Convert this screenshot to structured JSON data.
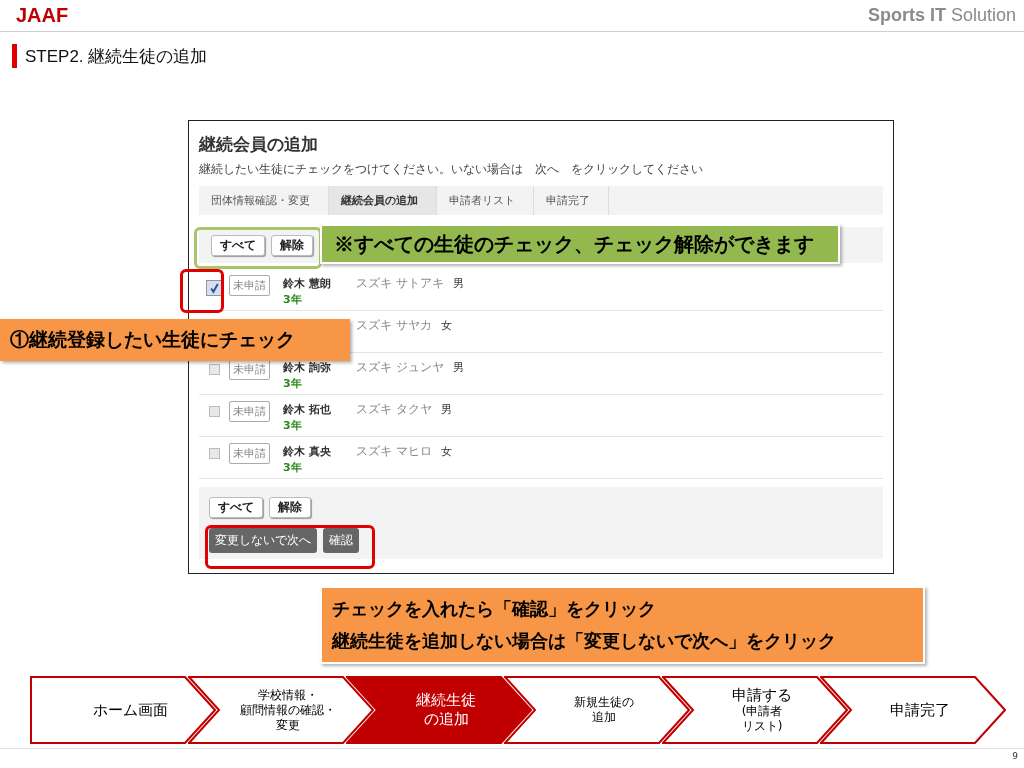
{
  "header": {
    "logo": "JAAF",
    "brand": "**Sports IT** Solution"
  },
  "slide_title": "STEP2. 継続生徒の追加",
  "screenshot": {
    "title": "継続会員の追加",
    "instruction": "継続したい生徒にチェックをつけてください。いない場合は　次へ　をクリックしてください",
    "breadcrumb": [
      {
        "label": "団体情報確認・変更",
        "selected": false
      },
      {
        "label": "継続会員の追加",
        "selected": true
      },
      {
        "label": "申請者リスト",
        "selected": false
      },
      {
        "label": "申請完了",
        "selected": false
      }
    ],
    "top_buttons": [
      "すべて",
      "解除"
    ],
    "students": [
      {
        "checked": true,
        "status": "未申請",
        "name": "鈴木 慧朗",
        "kana": "スズキ サトアキ",
        "gender": "男",
        "grade": "3年"
      },
      {
        "kana": "スズキ サヤカ",
        "gender": "女"
      },
      {
        "checked": false,
        "status": "未申請",
        "name": "鈴木 詢弥",
        "kana": "スズキ ジュンヤ",
        "gender": "男",
        "grade": "3年"
      },
      {
        "checked": false,
        "status": "未申請",
        "name": "鈴木 拓也",
        "kana": "スズキ タクヤ",
        "gender": "男",
        "grade": "3年"
      },
      {
        "checked": false,
        "status": "未申請",
        "name": "鈴木 真央",
        "kana": "スズキ マヒロ",
        "gender": "女",
        "grade": "3年"
      }
    ],
    "bottom_buttons": [
      "すべて",
      "解除"
    ],
    "action_buttons": [
      "変更しないで次へ",
      "確認"
    ]
  },
  "callouts": [
    {
      "kind": "green",
      "lines": [
        "※すべての生徒のチェック、チェック解除ができます"
      ]
    },
    {
      "kind": "orange-left",
      "lines": [
        "①継続登録したい生徒にチェック"
      ]
    },
    {
      "kind": "orange-bottom",
      "lines": [
        "チェックを入れたら「確認」をクリック",
        "継続生徒を追加しない場合は「変更しないで次へ」をクリック"
      ]
    }
  ],
  "steps": [
    {
      "lines": [
        "ホーム画面"
      ],
      "selected": false
    },
    {
      "lines": [
        "学校情報・",
        "顧問情報の確認・",
        "変更"
      ],
      "selected": false
    },
    {
      "lines": [
        "継続生徒",
        "の追加"
      ],
      "selected": true
    },
    {
      "lines": [
        "新規生徒の",
        "追加"
      ],
      "selected": false
    },
    {
      "lines": [
        "申請する",
        "(申請者",
        "リスト)"
      ],
      "selected": false
    },
    {
      "lines": [
        "申請完了"
      ],
      "selected": false
    }
  ],
  "page_number": "9"
}
